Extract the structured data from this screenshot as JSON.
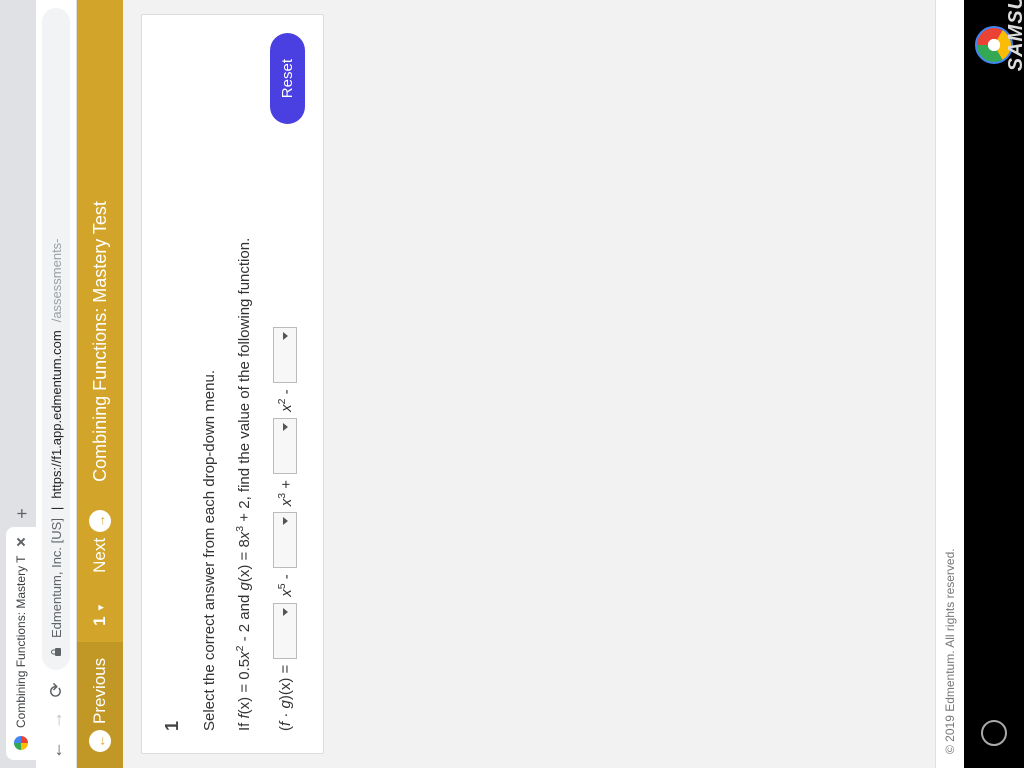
{
  "browser": {
    "tab_title": "Combining Functions: Mastery T",
    "new_tab_glyph": "+",
    "omnibox_origin": "Edmentum, Inc. [US]",
    "omnibox_url_host": "https://f1.app.edmentum.com",
    "omnibox_url_path": "/assessments-"
  },
  "goldbar": {
    "previous": "Previous",
    "question_number": "1",
    "next": "Next",
    "title": "Combining Functions: Mastery Test"
  },
  "question": {
    "number": "1",
    "instruction": "Select the correct answer from each drop-down menu.",
    "stmt_prefix": "If ",
    "stmt_f": "f",
    "stmt_fx_eq": "(x) = 0.5",
    "stmt_x2": "x",
    "stmt_x2_sup": "2",
    "stmt_mid": " - 2 and ",
    "stmt_g": "g",
    "stmt_gx_eq": "(x) = 8",
    "stmt_x3": "x",
    "stmt_x3_sup": "3",
    "stmt_suffix": " + 2, find the value of the following function.",
    "eq_lhs_open": "(",
    "eq_lhs_f": "f",
    "eq_lhs_dot": " · ",
    "eq_lhs_g": "g",
    "eq_lhs_close": ")(x) = ",
    "term1_var": "x",
    "term1_sup": "5",
    "term1_op": " - ",
    "term2_var": "x",
    "term2_sup": "3",
    "term2_op": " + ",
    "term3_var": "x",
    "term3_sup": "2",
    "term3_op": " - ",
    "reset": "Reset"
  },
  "footer": {
    "copyright": "© 2019 Edmentum. All rights reserved."
  },
  "device": {
    "brand": "SAMSU"
  }
}
